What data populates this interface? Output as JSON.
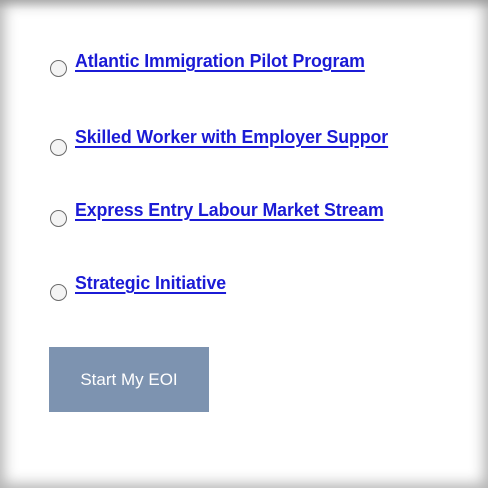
{
  "options": [
    {
      "label": "Atlantic Immigration Pilot Program",
      "selected": false
    },
    {
      "label": "Skilled Worker with Employer Suppor",
      "selected": false
    },
    {
      "label": "Express Entry Labour Market Stream",
      "selected": false
    },
    {
      "label": "Strategic Initiative",
      "selected": false
    }
  ],
  "start_button": {
    "label": "Start My EOI"
  },
  "colors": {
    "link": "#1b1bd6",
    "button_bg": "#7d93b0",
    "button_text": "#ffffff"
  }
}
